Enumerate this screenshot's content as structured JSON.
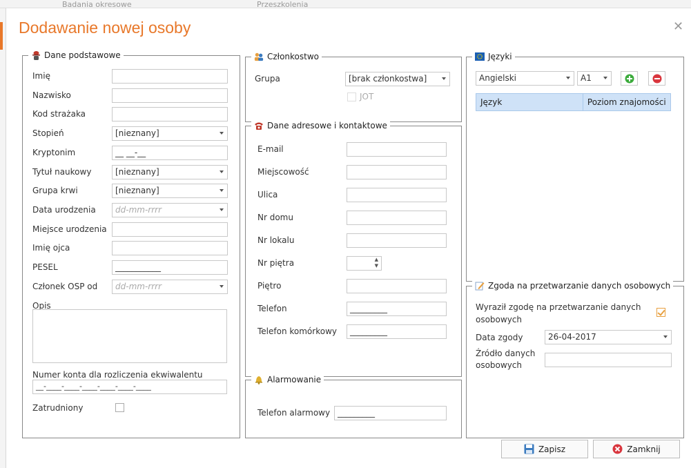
{
  "background": {
    "left_text": "Badania okresowe",
    "right_text": "Przeszkolenia"
  },
  "dialog": {
    "title": "Dodawanie nowej osoby"
  },
  "basic": {
    "legend": "Dane podstawowe",
    "fields": [
      {
        "label": "Imię",
        "value": ""
      },
      {
        "label": "Nazwisko",
        "value": ""
      },
      {
        "label": "Kod strażaka",
        "value": ""
      },
      {
        "label": "Stopień",
        "value": "[nieznany]"
      },
      {
        "label": "Kryptonim",
        "value": "__ __-__"
      },
      {
        "label": "Tytuł naukowy",
        "value": "[nieznany]"
      },
      {
        "label": "Grupa krwi",
        "value": "[nieznany]"
      },
      {
        "label": "Data urodzenia",
        "value": "dd-mm-rrrr"
      },
      {
        "label": "Miejsce urodzenia",
        "value": ""
      },
      {
        "label": "Imię ojca",
        "value": ""
      },
      {
        "label": "PESEL",
        "value": "___________"
      },
      {
        "label": "Członek OSP od",
        "value": "dd-mm-rrrr"
      }
    ],
    "opis_label": "Opis",
    "konto_label": "Numer konta dla rozliczenia ekwiwalentu",
    "konto_mask": "__-____-____-____-____-____-____",
    "zatrudniony_label": "Zatrudniony"
  },
  "membership": {
    "legend": "Członkostwo",
    "group_label": "Grupa",
    "group_value": "[brak członkostwa]",
    "jot_label": "JOT"
  },
  "contact": {
    "legend": "Dane adresowe i kontaktowe",
    "fields": [
      {
        "label": "E-mail",
        "value": ""
      },
      {
        "label": "Miejscowość",
        "value": ""
      },
      {
        "label": "Ulica",
        "value": ""
      },
      {
        "label": "Nr domu",
        "value": ""
      },
      {
        "label": "Nr lokalu",
        "value": ""
      },
      {
        "label": "Nr piętra",
        "value": ""
      },
      {
        "label": "Piętro",
        "value": ""
      },
      {
        "label": "Telefon",
        "value": "_________"
      },
      {
        "label": "Telefon komórkowy",
        "value": "_________"
      }
    ]
  },
  "alarm": {
    "legend": "Alarmowanie",
    "phone_label": "Telefon alarmowy",
    "phone_value": "_________"
  },
  "languages": {
    "legend": "Języki",
    "language_value": "Angielski",
    "level_value": "A1",
    "columns": [
      "Język",
      "Poziom znajomości"
    ]
  },
  "consent": {
    "legend": "Zgoda na przetwarzanie danych osobowych",
    "agreed_label": "Wyraził zgodę na przetwarzanie danych osobowych",
    "agreed": true,
    "date_label": "Data zgody",
    "date_value": "26-04-2017",
    "source_label": "Źródło danych osobowych",
    "source_value": ""
  },
  "footer": {
    "save_label": "Zapisz",
    "close_label": "Zamknij"
  },
  "colors": {
    "accent": "#e8782a",
    "table_header": "#cfe2f7",
    "check": "#e8a040",
    "add": "#3cab3c",
    "remove": "#d9363e"
  }
}
